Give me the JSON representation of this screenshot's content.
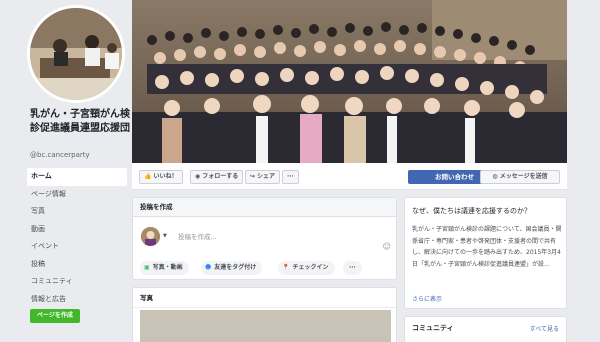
{
  "page": {
    "name": "乳がん・子宮頸がん検診促進議員連盟応援団",
    "handle": "@bc.cancerparty"
  },
  "nav": {
    "items": [
      {
        "label": "ホーム",
        "active": true
      },
      {
        "label": "ページ情報"
      },
      {
        "label": "写真"
      },
      {
        "label": "動画"
      },
      {
        "label": "イベント"
      },
      {
        "label": "投稿"
      },
      {
        "label": "コミュニティ"
      },
      {
        "label": "情報と広告"
      }
    ],
    "create_page": "ページを作成"
  },
  "actions": {
    "like": "いいね！",
    "follow": "フォローする",
    "share": "シェア",
    "more": "···",
    "contact": "お問い合わせ",
    "message": "メッセージを送信"
  },
  "composer": {
    "title": "投稿を作成",
    "placeholder": "投稿を作成...",
    "chips": [
      "写真・動画",
      "友達をタグ付け",
      "チェックイン",
      "···"
    ]
  },
  "photos": {
    "title": "写真"
  },
  "about": {
    "title": "なぜ、僕たちは議連を応援するのか？",
    "text": "乳がん・子宮頸がん検診の課題について、国会議員・関係省庁・専門家・患者や啓発団体・支援者の間で共有し、解決に向けての一歩を踏み出すため、2015年3月4日「乳がん・子宮頸がん検診促進議員連盟」が設...",
    "more": "さらに表示"
  },
  "community": {
    "title": "コミュニティ",
    "see_all": "すべて見る"
  },
  "colors": {
    "brand_blue": "#4267b2",
    "green": "#42b72a",
    "background": "#e9ebee"
  }
}
